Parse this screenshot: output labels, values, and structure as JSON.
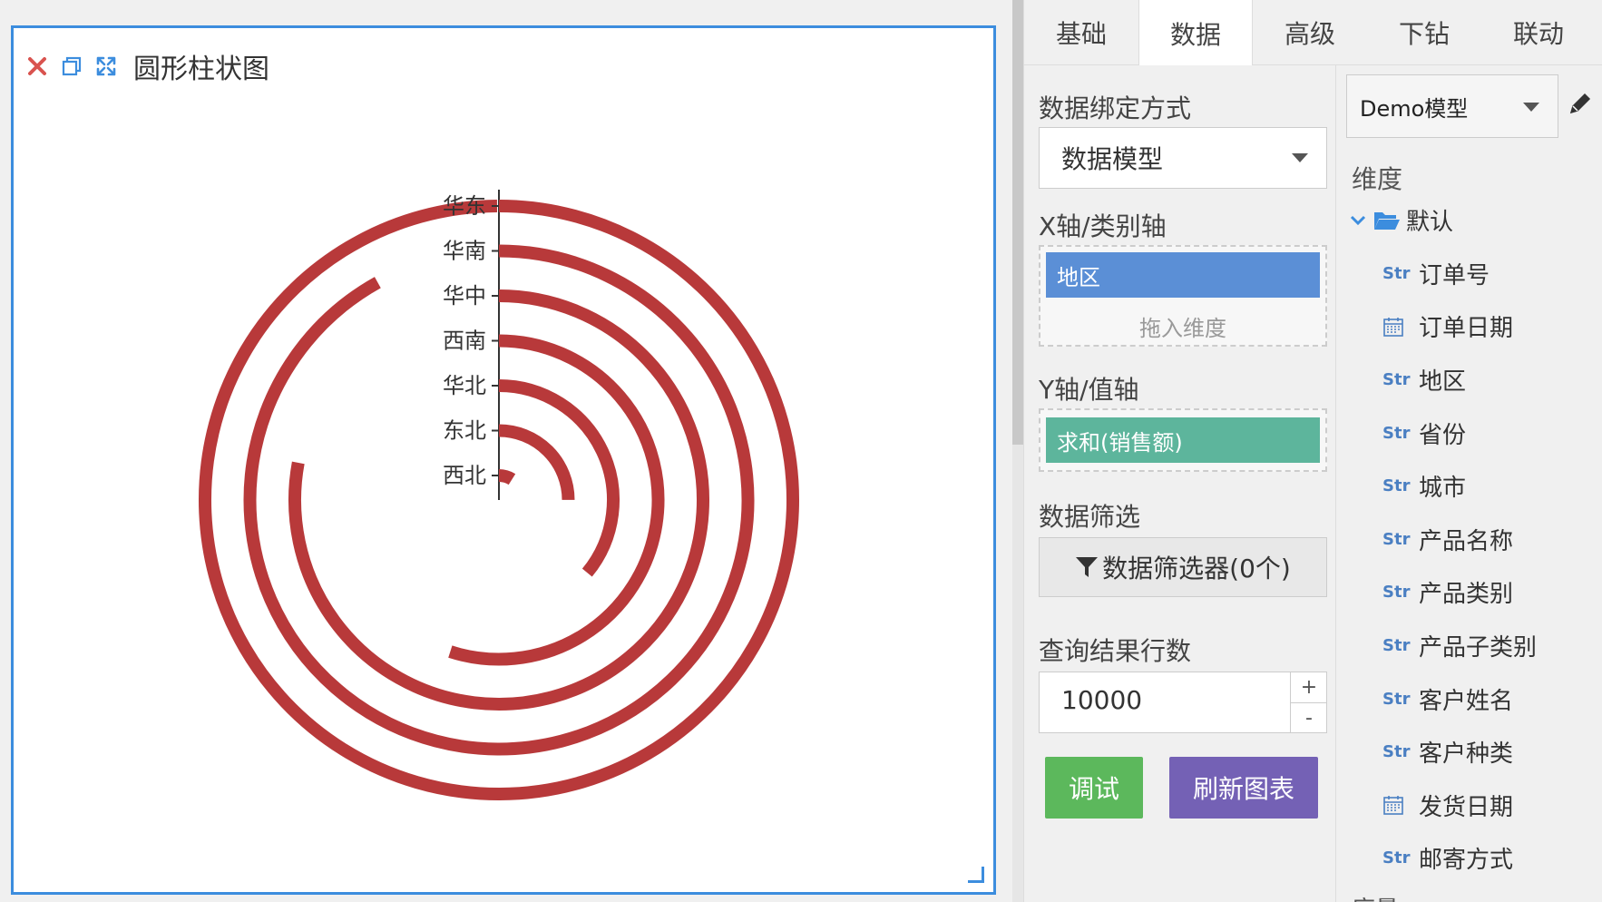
{
  "chart_panel": {
    "title": "圆形柱状图"
  },
  "chart_data": {
    "type": "bar",
    "orientation": "polar-radial",
    "categories": [
      "华东",
      "华南",
      "华中",
      "西南",
      "华北",
      "东北",
      "西北"
    ],
    "values": [
      100,
      92,
      78,
      55,
      36,
      25,
      9
    ],
    "series": [
      {
        "values": [
          100,
          92,
          78,
          55,
          36,
          25,
          9
        ],
        "color": "#b8393a"
      }
    ],
    "title": "",
    "xlabel": "",
    "ylabel": "",
    "grid": false
  },
  "tabs": [
    {
      "label": "基础"
    },
    {
      "label": "数据"
    },
    {
      "label": "高级"
    },
    {
      "label": "下钻"
    },
    {
      "label": "联动"
    }
  ],
  "active_tab": "数据",
  "data_settings": {
    "binding_label": "数据绑定方式",
    "binding_value": "数据模型",
    "x_axis_label": "X轴/类别轴",
    "x_axis_field": "地区",
    "x_axis_hint": "拖入维度",
    "y_axis_label": "Y轴/值轴",
    "y_axis_field": "求和(销售额)",
    "filter_label": "数据筛选",
    "filter_button": "数据筛选器(0个)",
    "rows_label": "查询结果行数",
    "rows_value": "10000",
    "step_plus": "+",
    "step_minus": "-",
    "debug_button": "调试",
    "refresh_button": "刷新图表"
  },
  "model_panel": {
    "model_value": "Demo模型",
    "dimension_title": "维度",
    "root_folder": "默认",
    "fields": [
      {
        "type": "Str",
        "name": "订单号"
      },
      {
        "type": "date",
        "name": "订单日期"
      },
      {
        "type": "Str",
        "name": "地区"
      },
      {
        "type": "Str",
        "name": "省份"
      },
      {
        "type": "Str",
        "name": "城市"
      },
      {
        "type": "Str",
        "name": "产品名称"
      },
      {
        "type": "Str",
        "name": "产品类别"
      },
      {
        "type": "Str",
        "name": "产品子类别"
      },
      {
        "type": "Str",
        "name": "客户姓名"
      },
      {
        "type": "Str",
        "name": "客户种类"
      },
      {
        "type": "date",
        "name": "发货日期"
      },
      {
        "type": "Str",
        "name": "邮寄方式"
      }
    ],
    "measure_title": "度量"
  },
  "colors": {
    "accent_blue": "#3c8dde",
    "bar_red": "#b8393a",
    "pill_blue": "#5b8fd6",
    "pill_green": "#5db59c",
    "debug_green": "#5cb85c",
    "refresh_purple": "#7461b5",
    "close_red": "#d9534f"
  }
}
